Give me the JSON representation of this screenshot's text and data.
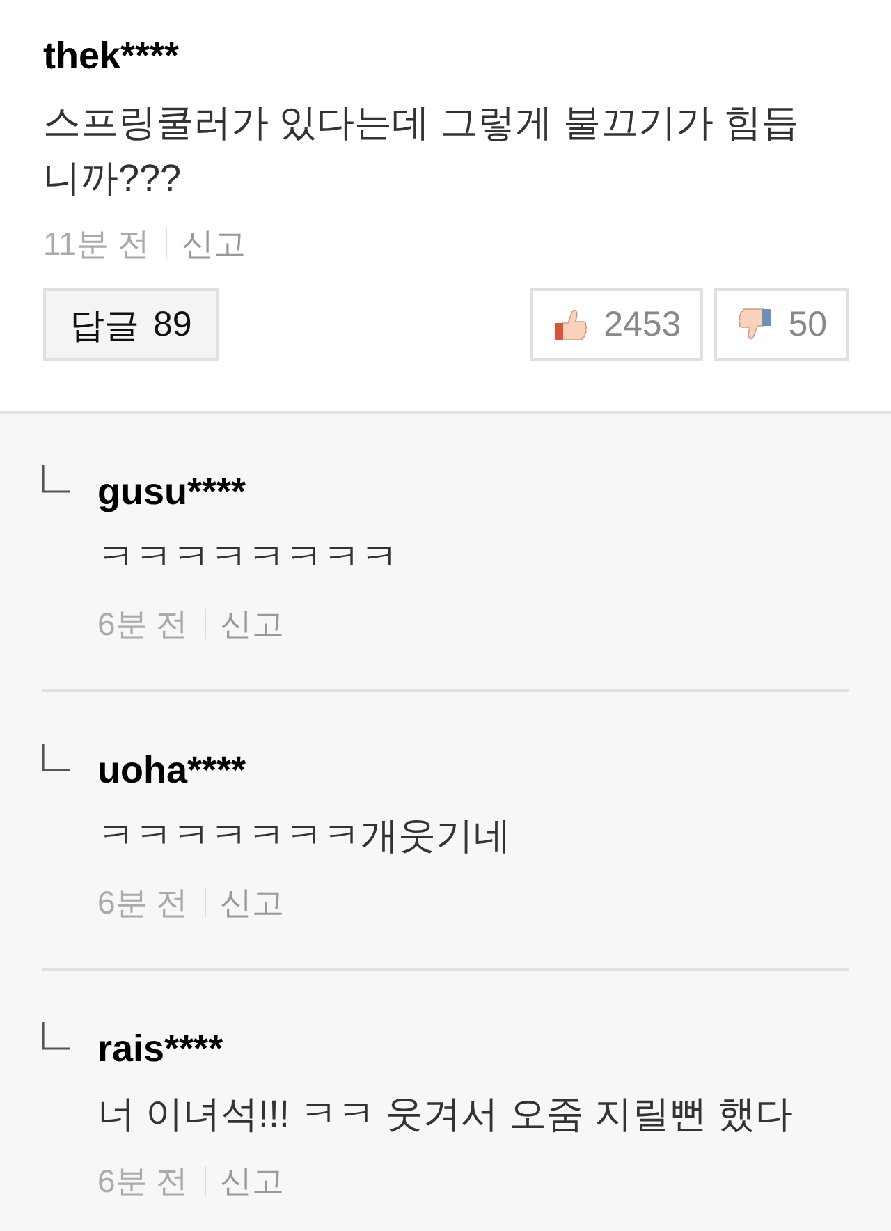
{
  "comment": {
    "author": "thek****",
    "text": "스프링쿨러가 있다는데 그렇게 불끄기가 힘듭니까???",
    "time": "11분 전",
    "report": "신고",
    "reply_button": {
      "label": "답글",
      "count": "89"
    },
    "likes": "2453",
    "dislikes": "50"
  },
  "replies": [
    {
      "author": "gusu****",
      "text": "ㅋㅋㅋㅋㅋㅋㅋㅋ",
      "time": "6분 전",
      "report": "신고"
    },
    {
      "author": "uoha****",
      "text": "ㅋㅋㅋㅋㅋㅋㅋ개웃기네",
      "time": "6분 전",
      "report": "신고"
    },
    {
      "author": "rais****",
      "text": "너 이녀석!!! ㅋㅋ 웃겨서 오줌 지릴뻔 했다",
      "time": "6분 전",
      "report": "신고"
    }
  ]
}
